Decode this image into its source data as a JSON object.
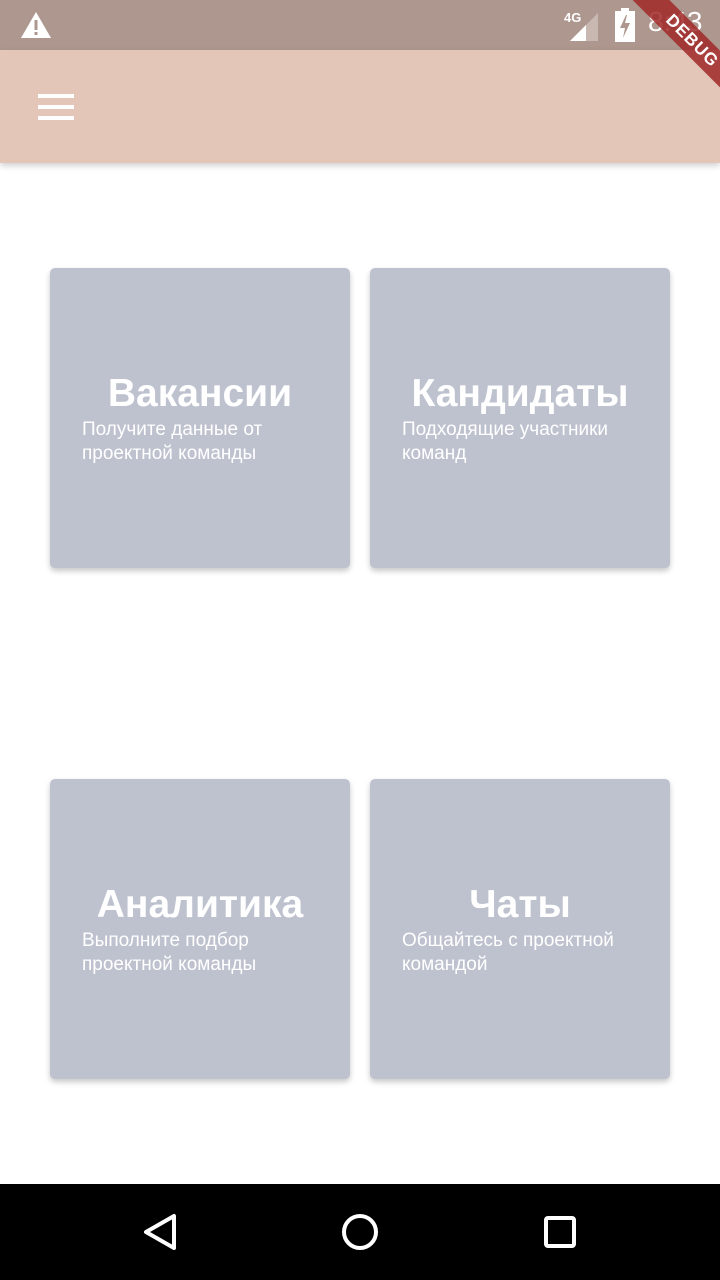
{
  "status_bar": {
    "network_type": "4G",
    "time": "8:43",
    "icons": [
      "warning-icon",
      "signal-icon",
      "battery-charging-icon"
    ]
  },
  "app_bar": {
    "menu_icon": "hamburger-menu-icon",
    "debug_banner": "DEBUG"
  },
  "cards": [
    {
      "title": "Вакансии",
      "description": "Получите данные от проектной команды"
    },
    {
      "title": "Кандидаты",
      "description": "Подходящие участники команд"
    },
    {
      "title": "Аналитика",
      "description": "Выполните подбор проектной команды"
    },
    {
      "title": "Чаты",
      "description": "Общайтесь с проектной командой"
    }
  ],
  "nav_bar": {
    "icons": [
      "back-icon",
      "home-icon",
      "recents-icon"
    ]
  },
  "colors": {
    "status_bar": "#ad978e",
    "app_bar": "#e4c6b9",
    "card": "#bec2cf",
    "nav_bar": "#000000",
    "debug_ribbon": "#a02828"
  }
}
